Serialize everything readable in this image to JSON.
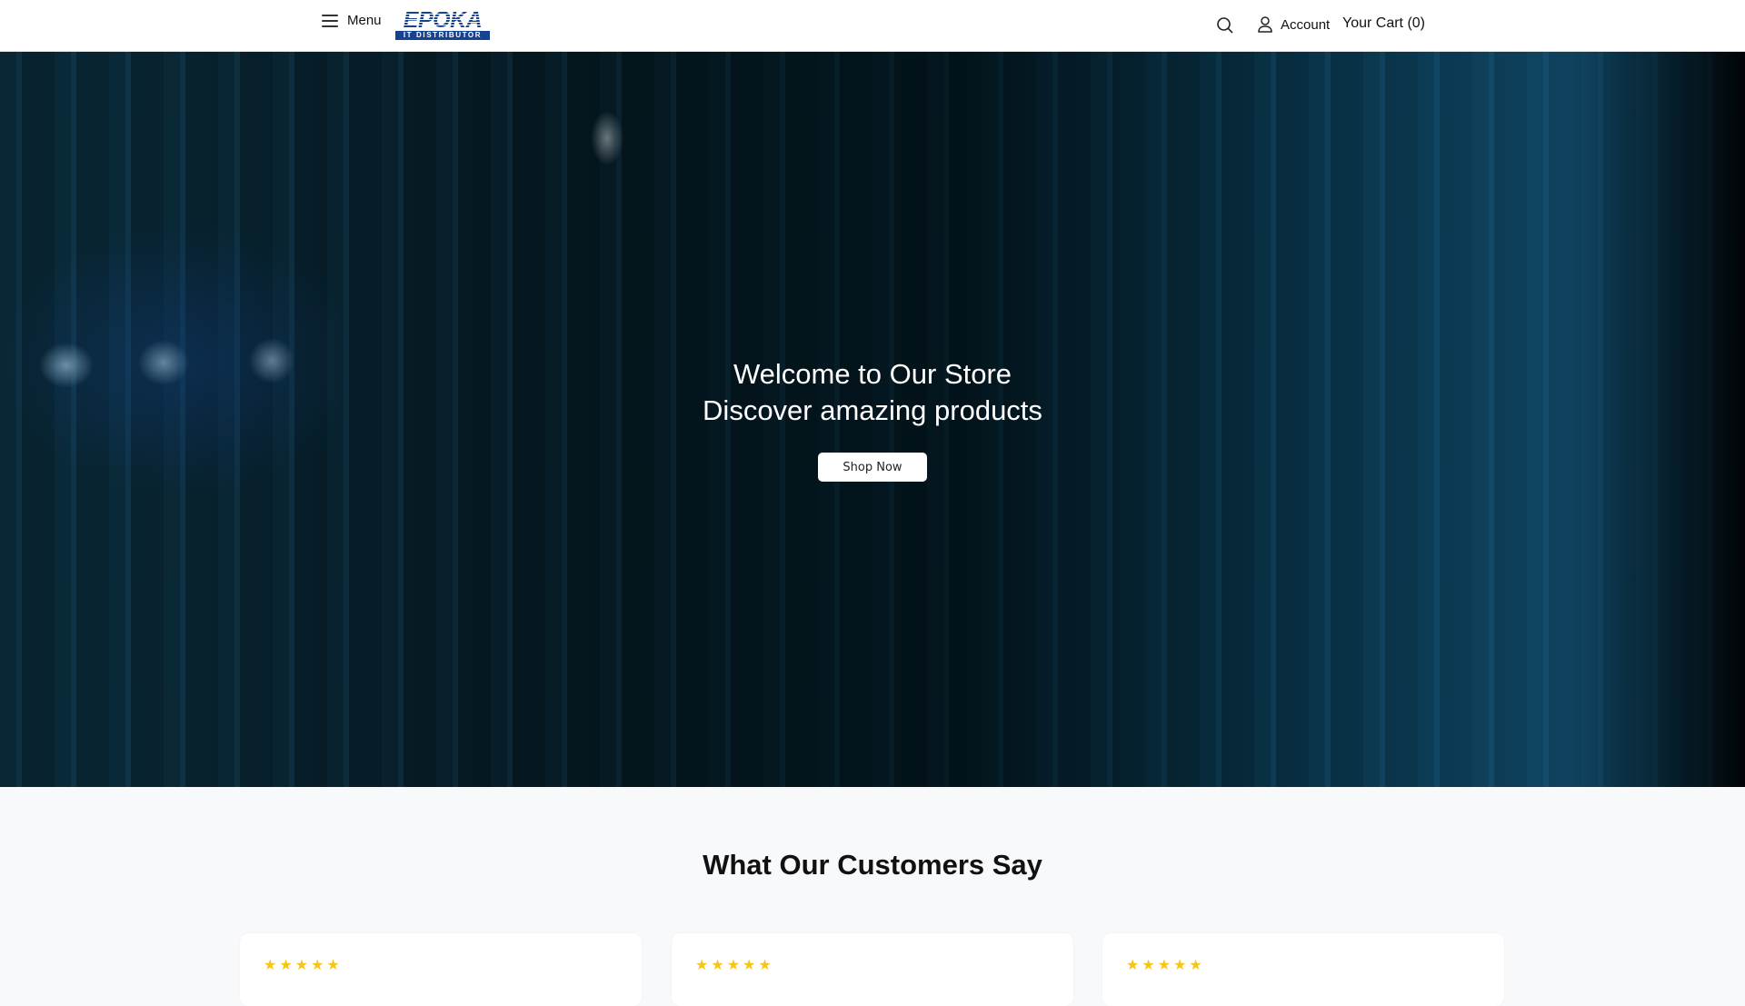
{
  "header": {
    "menu_label": "Menu",
    "logo_text": "EPOKA",
    "logo_subtext": "IT DISTRIBUTOR",
    "account_label": "Account",
    "cart_label": "Your Cart (0)",
    "icons": [
      "hamburger-icon",
      "search-icon",
      "user-icon"
    ]
  },
  "hero": {
    "line1": "Welcome to Our Store",
    "line2": "Discover amazing products",
    "button_label": "Shop Now"
  },
  "testimonials": {
    "title": "What Our Customers Say",
    "cards": [
      {
        "stars": "★★★★★",
        "rating": 5
      },
      {
        "stars": "★★★★★",
        "rating": 5
      },
      {
        "stars": "★★★★★",
        "rating": 5
      }
    ]
  },
  "colors": {
    "brand": "#16428f",
    "star": "#f5c518"
  }
}
